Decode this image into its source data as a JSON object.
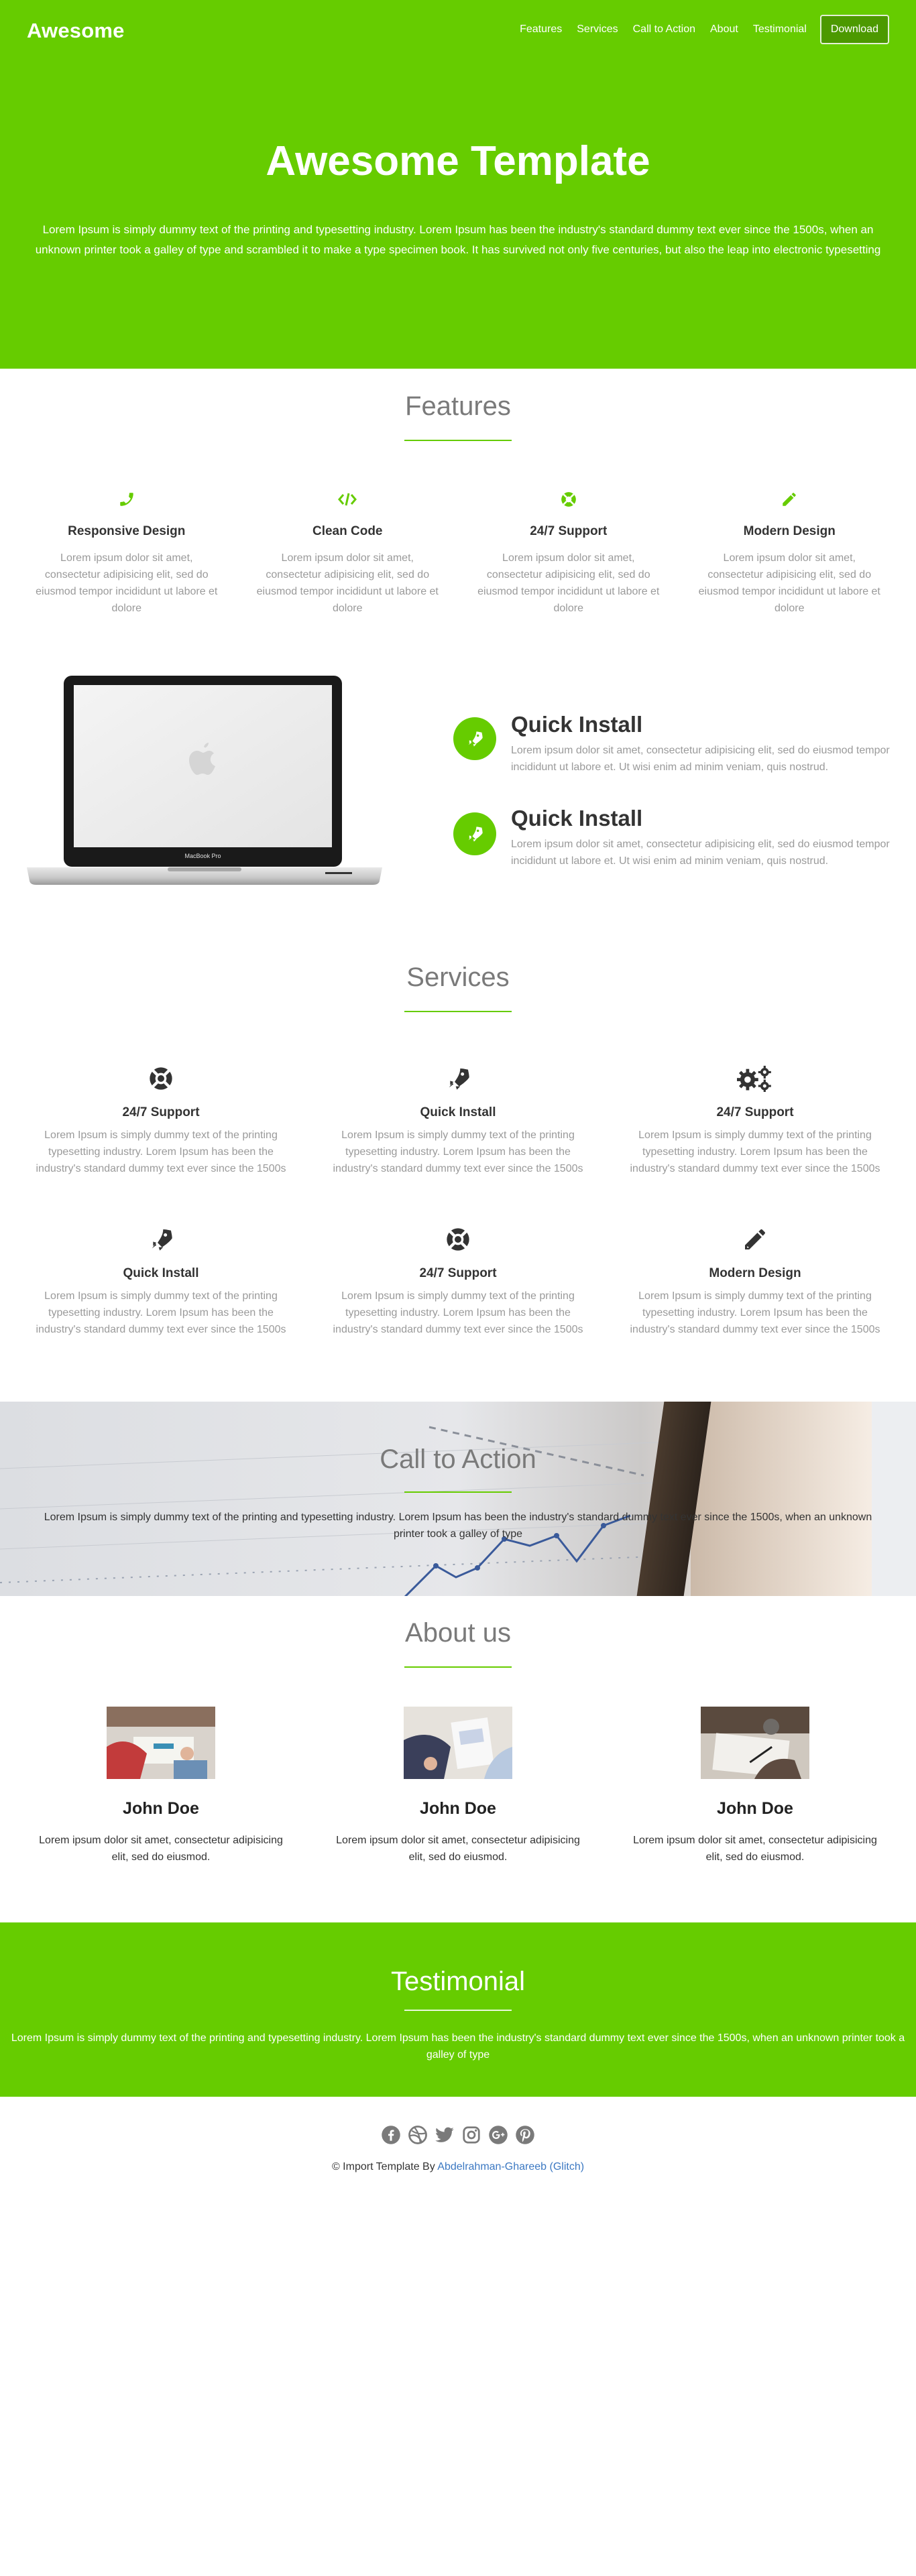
{
  "nav": {
    "brand": "Awesome",
    "links": [
      "Features",
      "Services",
      "Call to Action",
      "About",
      "Testimonial"
    ],
    "download": "Download"
  },
  "hero": {
    "title": "Awesome Template",
    "text": "Lorem Ipsum is simply dummy text of the printing and typesetting industry. Lorem Ipsum has been the industry's standard dummy text ever since the 1500s, when an unknown printer took a galley of type and scrambled it to make a type specimen book. It has survived not only five centuries, but also the leap into electronic typesetting"
  },
  "features": {
    "title": "Features",
    "items": [
      {
        "icon": "phone-icon",
        "title": "Responsive Design",
        "text": "Lorem ipsum dolor sit amet, consectetur adipisicing elit, sed do eiusmod tempor incididunt ut labore et dolore"
      },
      {
        "icon": "code-icon",
        "title": "Clean Code",
        "text": "Lorem ipsum dolor sit amet, consectetur adipisicing elit, sed do eiusmod tempor incididunt ut labore et dolore"
      },
      {
        "icon": "support-icon",
        "title": "24/7 Support",
        "text": "Lorem ipsum dolor sit amet, consectetur adipisicing elit, sed do eiusmod tempor incididunt ut labore et dolore"
      },
      {
        "icon": "pencil-icon",
        "title": "Modern Design",
        "text": "Lorem ipsum dolor sit amet, consectetur adipisicing elit, sed do eiusmod tempor incididunt ut labore et dolore"
      }
    ],
    "laptop_label": "MacBook Pro",
    "quick": [
      {
        "icon": "rocket-icon",
        "title": "Quick Install",
        "text": "Lorem ipsum dolor sit amet, consectetur adipisicing elit, sed do eiusmod tempor incididunt ut labore et. Ut wisi enim ad minim veniam, quis nostrud."
      },
      {
        "icon": "rocket-icon",
        "title": "Quick Install",
        "text": "Lorem ipsum dolor sit amet, consectetur adipisicing elit, sed do eiusmod tempor incididunt ut labore et. Ut wisi enim ad minim veniam, quis nostrud."
      }
    ]
  },
  "services": {
    "title": "Services",
    "items": [
      {
        "icon": "life-ring-icon",
        "title": "24/7 Support",
        "text": "Lorem Ipsum is simply dummy text of the printing typesetting industry. Lorem Ipsum has been the industry's standard dummy text ever since the 1500s"
      },
      {
        "icon": "rocket-icon",
        "title": "Quick Install",
        "text": "Lorem Ipsum is simply dummy text of the printing typesetting industry. Lorem Ipsum has been the industry's standard dummy text ever since the 1500s"
      },
      {
        "icon": "gears-icon",
        "title": "24/7 Support",
        "text": "Lorem Ipsum is simply dummy text of the printing typesetting industry. Lorem Ipsum has been the industry's standard dummy text ever since the 1500s"
      },
      {
        "icon": "rocket-icon",
        "title": "Quick Install",
        "text": "Lorem Ipsum is simply dummy text of the printing typesetting industry. Lorem Ipsum has been the industry's standard dummy text ever since the 1500s"
      },
      {
        "icon": "life-ring-icon",
        "title": "24/7 Support",
        "text": "Lorem Ipsum is simply dummy text of the printing typesetting industry. Lorem Ipsum has been the industry's standard dummy text ever since the 1500s"
      },
      {
        "icon": "pencil-icon",
        "title": "Modern Design",
        "text": "Lorem Ipsum is simply dummy text of the printing typesetting industry. Lorem Ipsum has been the industry's standard dummy text ever since the 1500s"
      }
    ]
  },
  "cta": {
    "title": "Call to Action",
    "text": "Lorem Ipsum is simply dummy text of the printing and typesetting industry. Lorem Ipsum has been the industry's standard dummy text ever since the 1500s, when an unknown printer took a galley of type"
  },
  "about": {
    "title": "About us",
    "members": [
      {
        "name": "John Doe",
        "text": "Lorem ipsum dolor sit amet, consectetur adipisicing elit, sed do eiusmod."
      },
      {
        "name": "John Doe",
        "text": "Lorem ipsum dolor sit amet, consectetur adipisicing elit, sed do eiusmod."
      },
      {
        "name": "John Doe",
        "text": "Lorem ipsum dolor sit amet, consectetur adipisicing elit, sed do eiusmod."
      }
    ]
  },
  "testimonial": {
    "title": "Testimonial",
    "text": "Lorem Ipsum is simply dummy text of the printing and typesetting industry. Lorem Ipsum has been the industry's standard dummy text ever since the 1500s, when an unknown printer took a galley of type"
  },
  "footer": {
    "social": [
      "facebook-icon",
      "dribbble-icon",
      "twitter-icon",
      "instagram-icon",
      "google-plus-icon",
      "pinterest-icon"
    ],
    "copyright": "© Import Template By",
    "author": "Abdelrahman-Ghareeb (Glitch)"
  },
  "colors": {
    "brand_green": "#66cc00",
    "download_bg": "#4c9900",
    "title_gray": "#7a7a7a",
    "muted_text": "#9a9a9a",
    "link_blue": "#3b78c2"
  }
}
